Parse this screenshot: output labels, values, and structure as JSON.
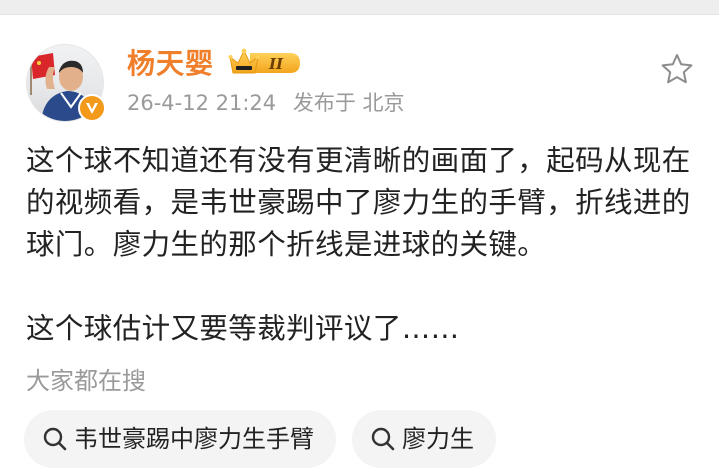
{
  "post": {
    "username": "杨天婴",
    "vip_level": "II",
    "timestamp": "26-4-12 21:24",
    "source": "发布于 北京",
    "paragraphs": [
      "这个球不知道还有没有更清晰的画面了，起码从现在的视频看，是韦世豪踢中了廖力生的手臂，折线进的球门。廖力生的那个折线是进球的关键。",
      "这个球估计又要等裁判评议了……"
    ]
  },
  "search": {
    "section_label": "大家都在搜",
    "chips": [
      {
        "label": "韦世豪踢中廖力生手臂",
        "icon": "search-icon"
      },
      {
        "label": "廖力生",
        "icon": "search-icon"
      }
    ]
  },
  "colors": {
    "username": "#f07f2b",
    "verified_badge": "#f39a1b",
    "vip_badge": "#f5b52a",
    "meta_text": "#9a9a9a",
    "chip_bg": "#f4f4f4"
  },
  "icons": {
    "favorite": "star-outline-icon",
    "verified": "verified-v-icon",
    "vip": "crown-vip-badge-icon"
  }
}
